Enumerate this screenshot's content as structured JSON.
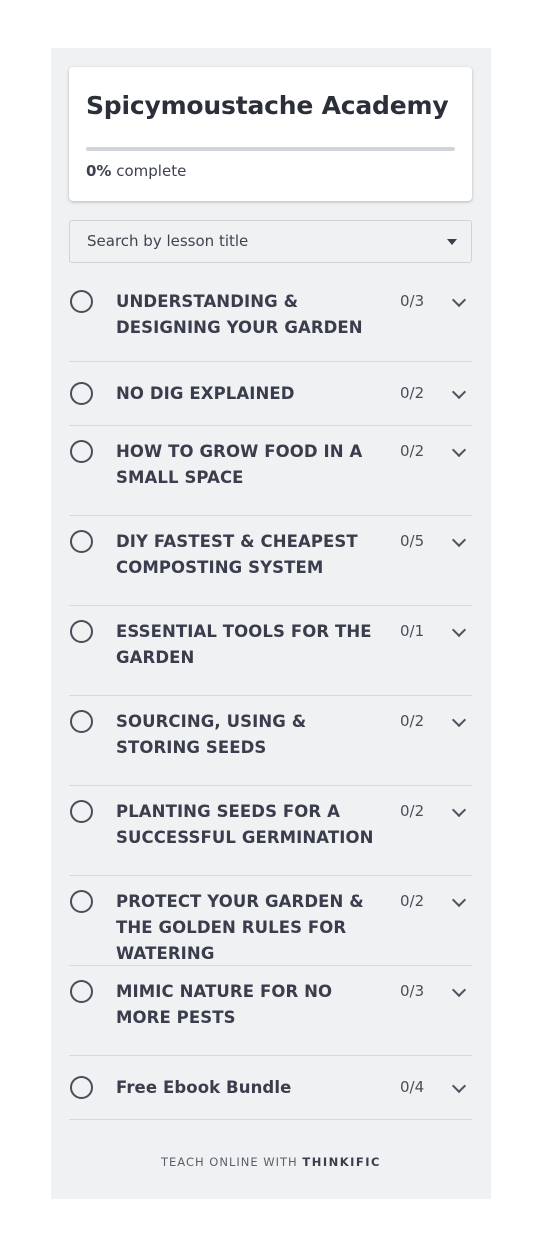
{
  "course": {
    "title": "Spicymoustache Academy",
    "progress_percent_label": "0%",
    "progress_suffix": "complete",
    "progress_fraction": 0
  },
  "search": {
    "placeholder": "Search by lesson title"
  },
  "chapters": [
    {
      "title": "UNDERSTANDING & DESIGNING YOUR GARDEN",
      "count": "0/3"
    },
    {
      "title": "NO DIG EXPLAINED",
      "count": "0/2"
    },
    {
      "title": "HOW TO GROW FOOD IN A SMALL SPACE",
      "count": "0/2"
    },
    {
      "title": "DIY FASTEST & CHEAPEST COMPOSTING SYSTEM",
      "count": "0/5"
    },
    {
      "title": "ESSENTIAL TOOLS FOR THE GARDEN",
      "count": "0/1"
    },
    {
      "title": "SOURCING, USING & STORING SEEDS",
      "count": "0/2"
    },
    {
      "title": "PLANTING SEEDS FOR A SUCCESSFUL GERMINATION",
      "count": "0/2"
    },
    {
      "title": "PROTECT YOUR GARDEN & THE GOLDEN RULES FOR WATERING",
      "count": "0/2"
    },
    {
      "title": "MIMIC NATURE FOR NO MORE PESTS",
      "count": "0/3"
    },
    {
      "title": "Free Ebook Bundle",
      "count": "0/4"
    }
  ],
  "footer": {
    "prefix": "TEACH ONLINE WITH",
    "brand": "THINKIFIC"
  },
  "colors": {
    "sidebar_bg": "#eff1f3",
    "progress_track": "#cfd3dc",
    "text_dark": "#383d4e"
  },
  "icons": {
    "chapter_status": "empty-circle-icon",
    "expand": "chevron-down-icon",
    "dropdown": "caret-down-icon"
  }
}
